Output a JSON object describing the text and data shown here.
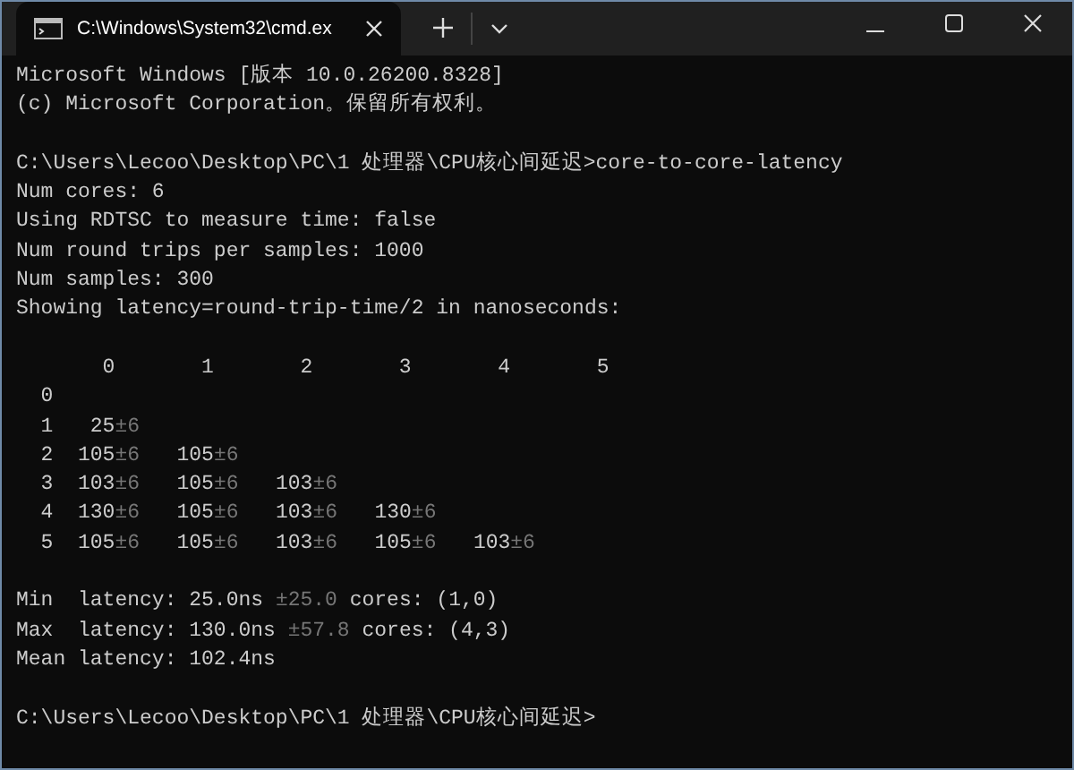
{
  "window": {
    "tab": {
      "title": "C:\\Windows\\System32\\cmd.ex",
      "selected": true
    }
  },
  "blocks": [
    {
      "lines": [
        [
          {
            "text": "Microsoft Windows [版本 10.0.26200.8328]",
            "dim": false
          }
        ],
        [
          {
            "text": "(c) Microsoft Corporation。保留所有权利。",
            "dim": false
          }
        ]
      ]
    },
    {
      "lines": [
        [
          {
            "text": "C:\\Users\\Lecoo\\Desktop\\PC\\1 处理器\\CPU核心间延迟>core-to-core-latency",
            "dim": false
          }
        ],
        [
          {
            "text": "Num cores: 6",
            "dim": false
          }
        ],
        [
          {
            "text": "Using RDTSC to measure time: false",
            "dim": false
          }
        ],
        [
          {
            "text": "Num round trips per samples: 1000",
            "dim": false
          }
        ],
        [
          {
            "text": "Num samples: 300",
            "dim": false
          }
        ],
        [
          {
            "text": "Showing latency=round-trip-time/2 in nanoseconds:",
            "dim": false
          }
        ]
      ]
    },
    {
      "lines": [
        [
          {
            "text": "       0       1       2       3       4       5",
            "dim": false
          }
        ],
        [
          {
            "text": "  0",
            "dim": false
          }
        ],
        [
          {
            "text": "  1   25",
            "dim": false
          },
          {
            "text": "±6",
            "dim": true
          }
        ],
        [
          {
            "text": "  2  105",
            "dim": false
          },
          {
            "text": "±6",
            "dim": true
          },
          {
            "text": "   105",
            "dim": false
          },
          {
            "text": "±6",
            "dim": true
          }
        ],
        [
          {
            "text": "  3  103",
            "dim": false
          },
          {
            "text": "±6",
            "dim": true
          },
          {
            "text": "   105",
            "dim": false
          },
          {
            "text": "±6",
            "dim": true
          },
          {
            "text": "   103",
            "dim": false
          },
          {
            "text": "±6",
            "dim": true
          }
        ],
        [
          {
            "text": "  4  130",
            "dim": false
          },
          {
            "text": "±6",
            "dim": true
          },
          {
            "text": "   105",
            "dim": false
          },
          {
            "text": "±6",
            "dim": true
          },
          {
            "text": "   103",
            "dim": false
          },
          {
            "text": "±6",
            "dim": true
          },
          {
            "text": "   130",
            "dim": false
          },
          {
            "text": "±6",
            "dim": true
          }
        ],
        [
          {
            "text": "  5  105",
            "dim": false
          },
          {
            "text": "±6",
            "dim": true
          },
          {
            "text": "   105",
            "dim": false
          },
          {
            "text": "±6",
            "dim": true
          },
          {
            "text": "   103",
            "dim": false
          },
          {
            "text": "±6",
            "dim": true
          },
          {
            "text": "   105",
            "dim": false
          },
          {
            "text": "±6",
            "dim": true
          },
          {
            "text": "   103",
            "dim": false
          },
          {
            "text": "±6",
            "dim": true
          }
        ]
      ]
    },
    {
      "lines": [
        [
          {
            "text": "Min  latency: 25.0ns ",
            "dim": false
          },
          {
            "text": "±25.0",
            "dim": true
          },
          {
            "text": " cores: (1,0)",
            "dim": false
          }
        ],
        [
          {
            "text": "Max  latency: 130.0ns ",
            "dim": false
          },
          {
            "text": "±57.8",
            "dim": true
          },
          {
            "text": " cores: (4,3)",
            "dim": false
          }
        ],
        [
          {
            "text": "Mean latency: 102.4ns",
            "dim": false
          }
        ]
      ]
    },
    {
      "lines": [
        [
          {
            "text": "C:\\Users\\Lecoo\\Desktop\\PC\\1 处理器\\CPU核心间延迟>",
            "dim": false
          }
        ]
      ]
    }
  ]
}
